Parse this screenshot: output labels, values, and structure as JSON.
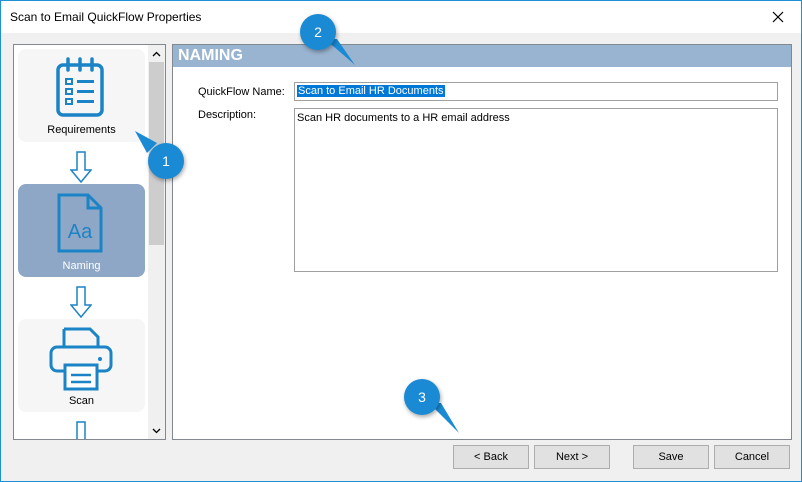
{
  "window": {
    "title": "Scan to Email QuickFlow Properties",
    "close_glyph": "✕"
  },
  "nav": {
    "items": [
      {
        "label": "Requirements",
        "icon": "clipboard-list-icon"
      },
      {
        "label": "Naming",
        "icon": "text-document-icon",
        "icon_text": "Aa"
      },
      {
        "label": "Scan",
        "icon": "printer-icon"
      }
    ]
  },
  "section": {
    "title": "NAMING"
  },
  "form": {
    "name_label": "QuickFlow Name:",
    "name_value": "Scan to Email HR Documents",
    "description_label": "Description:",
    "description_value": "Scan HR documents to a HR email address"
  },
  "buttons": {
    "back": "< Back",
    "next": "Next >",
    "save": "Save",
    "cancel": "Cancel"
  },
  "callouts": [
    "1",
    "2",
    "3"
  ],
  "colors": {
    "accent": "#1a8ad4",
    "selected_nav": "#8fa7c6",
    "section_header": "#99b4d1",
    "icon_blue": "#1b84c6"
  }
}
